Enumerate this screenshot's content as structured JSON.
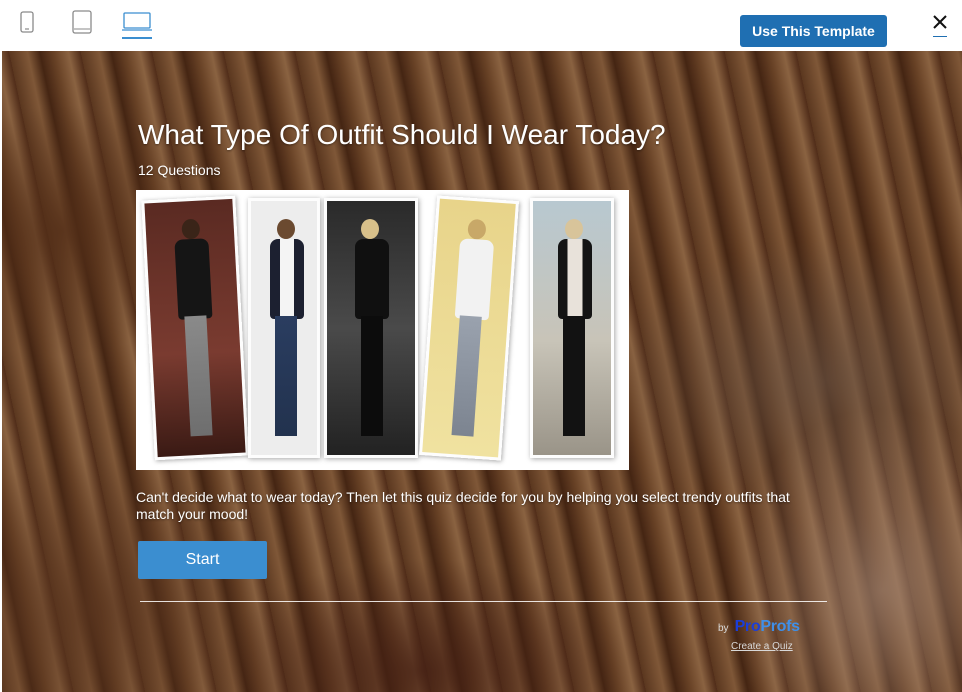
{
  "toolbar": {
    "devices": [
      {
        "icon": "phone-icon",
        "active": false
      },
      {
        "icon": "tablet-icon",
        "active": false
      },
      {
        "icon": "desktop-icon",
        "active": true
      }
    ],
    "use_template_label": "Use This Template",
    "close_icon": "close-icon"
  },
  "quiz": {
    "title": "What Type Of Outfit Should I Wear Today?",
    "question_count": "12 Questions",
    "description": "Can't decide what to wear today? Then let this quiz decide for you by helping you select trendy outfits that match your mood!",
    "start_label": "Start"
  },
  "footer": {
    "by_label": "by",
    "logo_part1": "Pro",
    "logo_part2": "Profs",
    "create_label": "Create a Quiz"
  },
  "colors": {
    "accent": "#1f6fb2",
    "start_button": "#3b8ed0",
    "logo_dark": "#1a3ed8",
    "logo_light": "#3f8fe8"
  }
}
